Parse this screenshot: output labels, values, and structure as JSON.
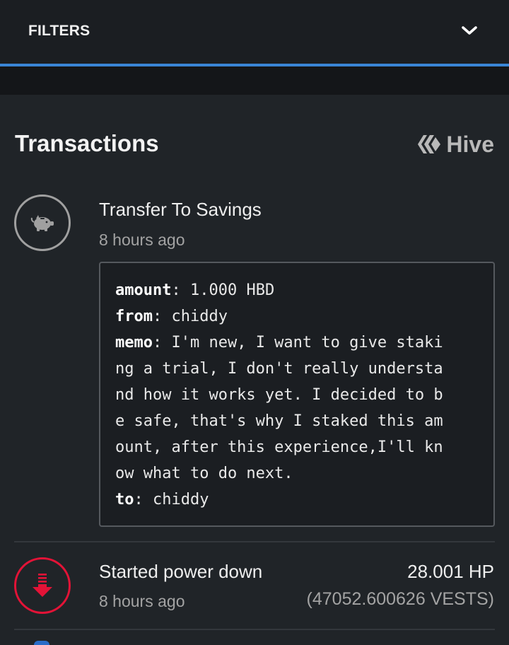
{
  "colors": {
    "accent": "#3a85d6",
    "danger": "#e31337",
    "muted_icon": "#a0a0a0"
  },
  "filters": {
    "label": "FILTERS",
    "toggle_icon": "chevron-down-icon"
  },
  "transactions": {
    "title": "Transactions",
    "brand": {
      "label": "Hive",
      "icon": "hive-logo-icon"
    },
    "items": [
      {
        "type": "transfer_to_savings",
        "icon": "piggy-bank-icon",
        "title": "Transfer To Savings",
        "time": "8 hours ago",
        "details": [
          {
            "key": "amount",
            "sep": ": ",
            "value": "1.000 HBD"
          },
          {
            "key": "from",
            "sep": ": ",
            "value": "chiddy"
          },
          {
            "key": "memo",
            "sep": ": ",
            "value": "I'm new, I want to give staki"
          },
          {
            "key": "",
            "sep": "",
            "value": "ng a trial, I don't really understa"
          },
          {
            "key": "",
            "sep": "",
            "value": "nd how it works yet. I decided to b"
          },
          {
            "key": "",
            "sep": "",
            "value": "e safe, that's why I staked this am"
          },
          {
            "key": "",
            "sep": "",
            "value": "ount, after this experience,I'll kn"
          },
          {
            "key": "",
            "sep": "",
            "value": "ow what to do next."
          },
          {
            "key": "to",
            "sep": ": ",
            "value": "chiddy"
          }
        ]
      },
      {
        "type": "power_down",
        "icon": "power-down-icon",
        "title": "Started power down",
        "time": "8 hours ago",
        "amount": "28.001 HP",
        "amount_sub": "(47052.600626 VESTS)"
      }
    ]
  }
}
